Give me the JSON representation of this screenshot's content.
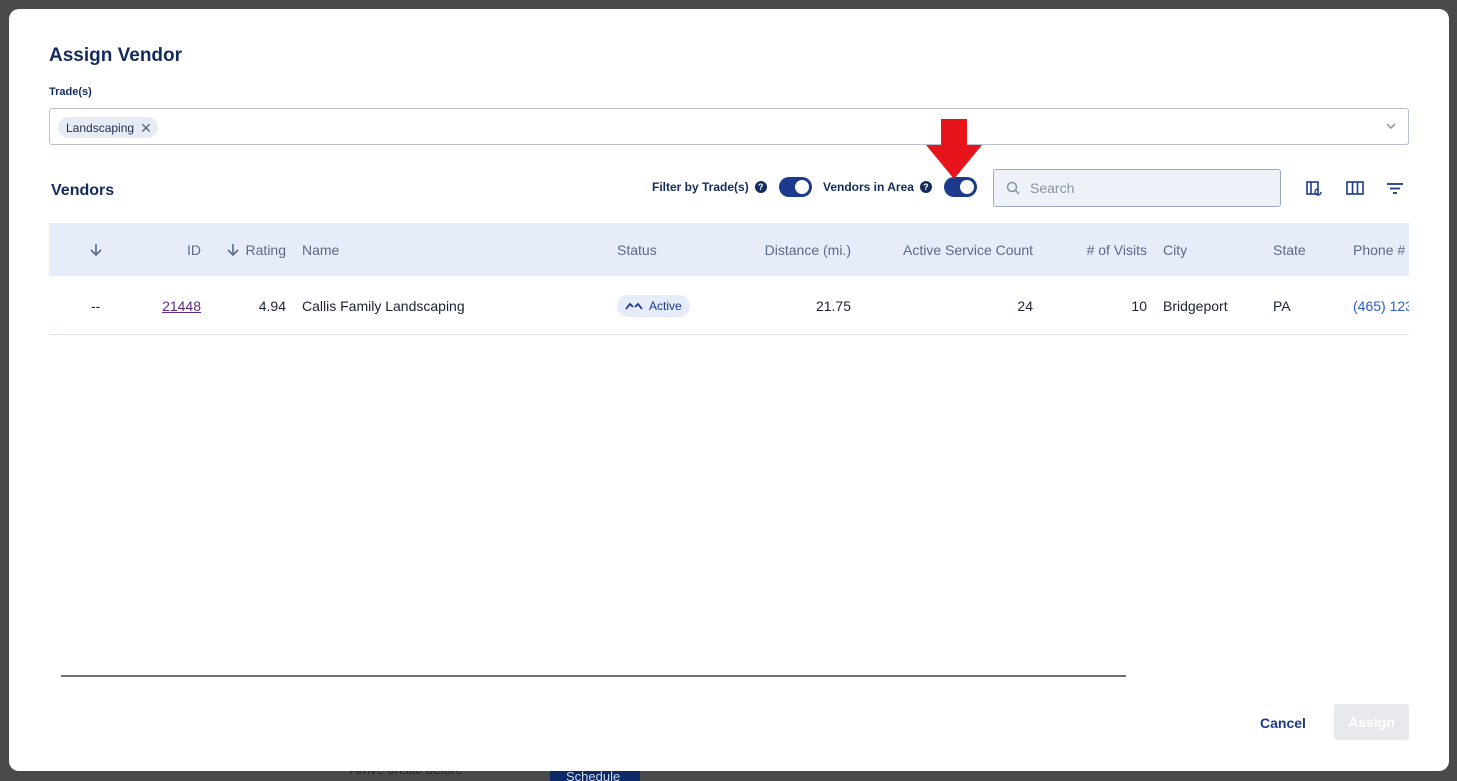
{
  "modal": {
    "title": "Assign Vendor",
    "trades_label": "Trade(s)",
    "selected_trades": [
      "Landscaping"
    ]
  },
  "vendors": {
    "title": "Vendors",
    "filter_by_trades_label": "Filter by Trade(s)",
    "filter_by_trades_on": true,
    "vendors_in_area_label": "Vendors in Area",
    "vendors_in_area_on": true,
    "search_placeholder": "Search"
  },
  "table": {
    "columns": [
      "",
      "ID",
      "Rating",
      "Name",
      "Status",
      "Distance (mi.)",
      "Active Service Count",
      "# of Visits",
      "City",
      "State",
      "Phone #"
    ],
    "rows": [
      {
        "select": "--",
        "id": "21448",
        "rating": "4.94",
        "name": "Callis Family Landscaping",
        "status": "Active",
        "distance": "21.75",
        "active_service_count": "24",
        "visits": "10",
        "city": "Bridgeport",
        "state": "PA",
        "phone": "(465) 123"
      }
    ]
  },
  "footer": {
    "cancel_label": "Cancel",
    "assign_label": "Assign"
  },
  "background": {
    "bottom_text": "Arrive onsite before",
    "schedule_label": "Schedule"
  },
  "colors": {
    "primary": "#1b3a8c",
    "title": "#142c5c",
    "header_bg": "#e6ecfa",
    "arrow": "#e8141b"
  }
}
